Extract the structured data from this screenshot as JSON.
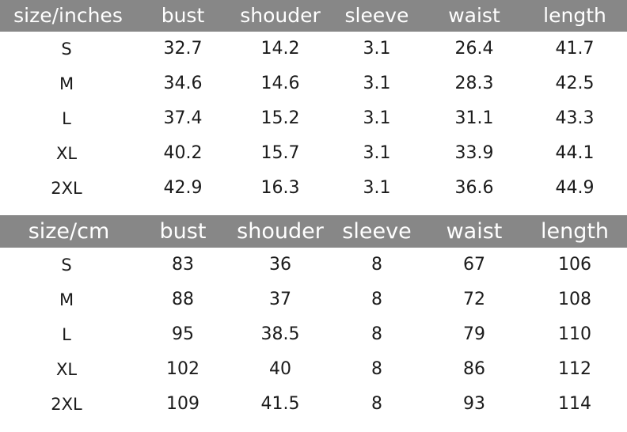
{
  "chart_data": {
    "type": "table",
    "title": "",
    "tables": [
      {
        "id": "inches",
        "unit": "inches",
        "columns": [
          "size/inches",
          "bust",
          "shouder",
          "sleeve",
          "waist",
          "length"
        ],
        "rows": [
          [
            "S",
            "32.7",
            "14.2",
            "3.1",
            "26.4",
            "41.7"
          ],
          [
            "M",
            "34.6",
            "14.6",
            "3.1",
            "28.3",
            "42.5"
          ],
          [
            "L",
            "37.4",
            "15.2",
            "3.1",
            "31.1",
            "43.3"
          ],
          [
            "XL",
            "40.2",
            "15.7",
            "3.1",
            "33.9",
            "44.1"
          ],
          [
            "2XL",
            "42.9",
            "16.3",
            "3.1",
            "36.6",
            "44.9"
          ]
        ]
      },
      {
        "id": "cm",
        "unit": "cm",
        "columns": [
          "size/cm",
          "bust",
          "shouder",
          "sleeve",
          "waist",
          "length"
        ],
        "rows": [
          [
            "S",
            "83",
            "36",
            "8",
            "67",
            "106"
          ],
          [
            "M",
            "88",
            "37",
            "8",
            "72",
            "108"
          ],
          [
            "L",
            "95",
            "38.5",
            "8",
            "79",
            "110"
          ],
          [
            "XL",
            "102",
            "40",
            "8",
            "86",
            "112"
          ],
          [
            "2XL",
            "109",
            "41.5",
            "8",
            "93",
            "114"
          ]
        ]
      }
    ],
    "colors": {
      "header_background": "#878787",
      "header_text": "#ffffff",
      "body_background": "#ffffff",
      "body_text": "#1b1b1b"
    }
  },
  "tables": {
    "inches": {
      "header": {
        "size": "size/inches",
        "bust": "bust",
        "shoulder": "shouder",
        "sleeve": "sleeve",
        "waist": "waist",
        "length": "length"
      },
      "rows": [
        {
          "size": "S",
          "bust": "32.7",
          "shoulder": "14.2",
          "sleeve": "3.1",
          "waist": "26.4",
          "length": "41.7"
        },
        {
          "size": "M",
          "bust": "34.6",
          "shoulder": "14.6",
          "sleeve": "3.1",
          "waist": "28.3",
          "length": "42.5"
        },
        {
          "size": "L",
          "bust": "37.4",
          "shoulder": "15.2",
          "sleeve": "3.1",
          "waist": "31.1",
          "length": "43.3"
        },
        {
          "size": "XL",
          "bust": "40.2",
          "shoulder": "15.7",
          "sleeve": "3.1",
          "waist": "33.9",
          "length": "44.1"
        },
        {
          "size": "2XL",
          "bust": "42.9",
          "shoulder": "16.3",
          "sleeve": "3.1",
          "waist": "36.6",
          "length": "44.9"
        }
      ]
    },
    "cm": {
      "header": {
        "size": "size/cm",
        "bust": "bust",
        "shoulder": "shouder",
        "sleeve": "sleeve",
        "waist": "waist",
        "length": "length"
      },
      "rows": [
        {
          "size": "S",
          "bust": "83",
          "shoulder": "36",
          "sleeve": "8",
          "waist": "67",
          "length": "106"
        },
        {
          "size": "M",
          "bust": "88",
          "shoulder": "37",
          "sleeve": "8",
          "waist": "72",
          "length": "108"
        },
        {
          "size": "L",
          "bust": "95",
          "shoulder": "38.5",
          "sleeve": "8",
          "waist": "79",
          "length": "110"
        },
        {
          "size": "XL",
          "bust": "102",
          "shoulder": "40",
          "sleeve": "8",
          "waist": "86",
          "length": "112"
        },
        {
          "size": "2XL",
          "bust": "109",
          "shoulder": "41.5",
          "sleeve": "8",
          "waist": "93",
          "length": "114"
        }
      ]
    }
  }
}
